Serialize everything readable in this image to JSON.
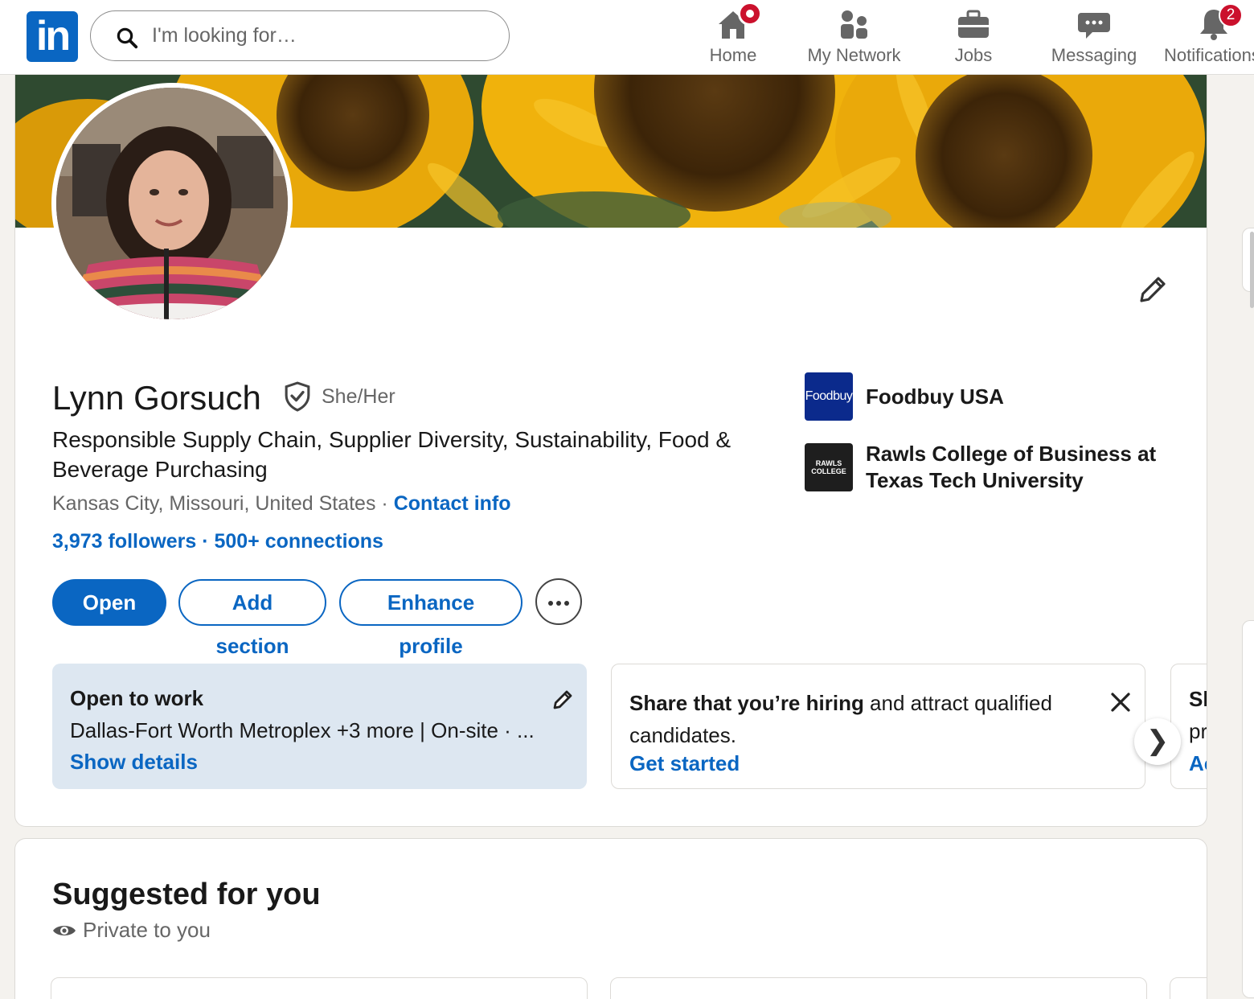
{
  "nav": {
    "logo_text": "in",
    "search_placeholder": "I'm looking for…",
    "items": [
      {
        "label": "Home",
        "icon": "home-icon"
      },
      {
        "label": "My Network",
        "icon": "people-icon"
      },
      {
        "label": "Jobs",
        "icon": "briefcase-icon"
      },
      {
        "label": "Messaging",
        "icon": "chat-icon"
      },
      {
        "label": "Notifications",
        "icon": "bell-icon",
        "badge": "2"
      }
    ]
  },
  "profile": {
    "name": "Lynn Gorsuch",
    "pronouns": "She/Her",
    "headline": "Responsible Supply Chain, Supplier Diversity, Sustainability, Food & Beverage Purchasing",
    "location": "Kansas City, Missouri, United States",
    "contact_link": "Contact info",
    "stats": "3,973 followers · 500+ connections",
    "orgs": [
      {
        "name": "Foodbuy USA",
        "logo_text": "Foodbuy"
      },
      {
        "name": "Rawls College of Business at Texas Tech University",
        "logo_text": "RAWLS COLLEGE"
      }
    ],
    "buttons": {
      "open_to": "Open to",
      "add_section": "Add section",
      "enhance": "Enhance profile"
    },
    "open_to_work": {
      "title": "Open to work",
      "summary": "Dallas-Fort Worth Metroplex +3 more | On-site · ...",
      "link": "Show details"
    },
    "hiring": {
      "bold": "Share that you’re hiring",
      "rest": " and attract qualified candidates.",
      "link": "Get started"
    },
    "peek": {
      "line1": "Sh",
      "line2": "pr",
      "line3": "Ac"
    }
  },
  "suggested": {
    "title": "Suggested for you",
    "privacy": "Private to you"
  },
  "colors": {
    "brand": "#0a66c2",
    "badge": "#cb112d",
    "open_to_work_bg": "#dde7f1"
  }
}
